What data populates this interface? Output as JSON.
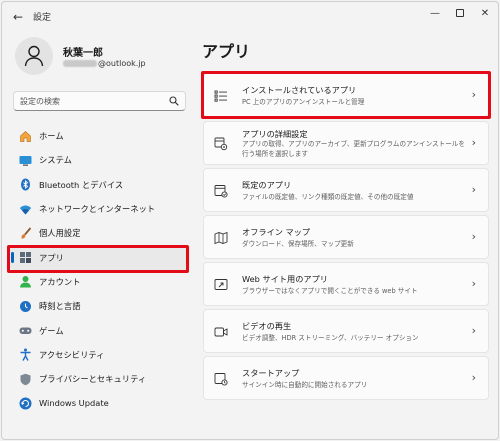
{
  "window": {
    "title": "設定",
    "back_glyph": "←",
    "min_glyph": "—",
    "close_glyph": "✕"
  },
  "account": {
    "name": "秋葉一郎",
    "email_suffix": "@outlook.jp"
  },
  "search": {
    "placeholder": "設定の検索"
  },
  "nav": {
    "items": [
      {
        "label": "ホーム",
        "icon": "home-icon"
      },
      {
        "label": "システム",
        "icon": "system-icon"
      },
      {
        "label": "Bluetooth とデバイス",
        "icon": "bluetooth-icon"
      },
      {
        "label": "ネットワークとインターネット",
        "icon": "network-icon"
      },
      {
        "label": "個人用設定",
        "icon": "personalization-icon"
      },
      {
        "label": "アプリ",
        "icon": "apps-icon",
        "active": true
      },
      {
        "label": "アカウント",
        "icon": "account-icon"
      },
      {
        "label": "時刻と言語",
        "icon": "time-language-icon"
      },
      {
        "label": "ゲーム",
        "icon": "gaming-icon"
      },
      {
        "label": "アクセシビリティ",
        "icon": "accessibility-icon"
      },
      {
        "label": "プライバシーとセキュリティ",
        "icon": "privacy-icon"
      },
      {
        "label": "Windows Update",
        "icon": "windows-update-icon"
      }
    ]
  },
  "main": {
    "title": "アプリ",
    "cards": [
      {
        "title": "インストールされているアプリ",
        "desc": "PC 上のアプリのアンインストールと管理",
        "icon": "installed-apps-icon"
      },
      {
        "title": "アプリの詳細設定",
        "desc": "アプリの取得、アプリのアーカイブ、更新プログラムのアンインストールを行う場所を選択します",
        "icon": "advanced-app-settings-icon"
      },
      {
        "title": "既定のアプリ",
        "desc": "ファイルの既定値、リンク種類の既定値、その他の既定値",
        "icon": "default-apps-icon"
      },
      {
        "title": "オフライン マップ",
        "desc": "ダウンロード、保存場所、マップ更新",
        "icon": "offline-maps-icon"
      },
      {
        "title": "Web サイト用のアプリ",
        "desc": "ブラウザーではなくアプリで開くことができる web サイト",
        "icon": "apps-for-websites-icon"
      },
      {
        "title": "ビデオの再生",
        "desc": "ビデオ調整、HDR ストリーミング、バッテリー オプション",
        "icon": "video-playback-icon"
      },
      {
        "title": "スタートアップ",
        "desc": "サインイン時に自動的に開始されるアプリ",
        "icon": "startup-icon"
      }
    ],
    "chevron": "›"
  },
  "colors": {
    "accent": "#0067c0",
    "highlight": "#e30b17"
  }
}
